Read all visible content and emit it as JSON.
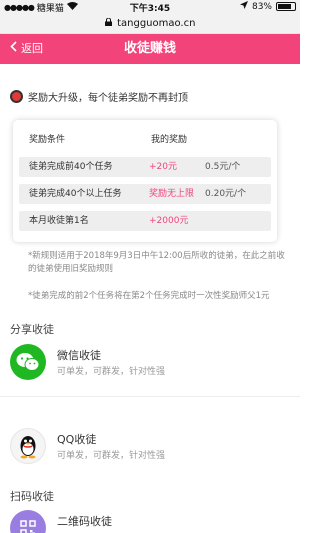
{
  "status_bar": {
    "carrier": "糖果猫",
    "time": "下午3:45",
    "battery_text": "83%",
    "battery_level": 0.83
  },
  "url_bar": {
    "url": "tangguomao.cn"
  },
  "header": {
    "back_label": "返回",
    "title": "收徒赚钱"
  },
  "notice": {
    "text": "奖励大升级，每个徒弟奖励不再封顶"
  },
  "reward_table": {
    "headers": [
      "奖励条件",
      "我的奖励"
    ],
    "rows": [
      {
        "condition": "徒弟完成前40个任务",
        "reward": "+20元",
        "unit": "0.5元/个"
      },
      {
        "condition": "徒弟完成40个以上任务",
        "reward": "奖励无上限",
        "unit": "0.20元/个"
      },
      {
        "condition": "本月收徒第1名",
        "reward": "+2000元",
        "unit": ""
      }
    ]
  },
  "notes": [
    "*新规则适用于2018年9月3日中午12:00后所收的徒弟，在此之前收的徒弟使用旧奖励规则",
    "*徒弟完成的前2个任务将在第2个任务完成时一次性奖励师父1元"
  ],
  "share_section": {
    "title": "分享收徒",
    "items": [
      {
        "name": "微信收徒",
        "desc": "可单发，可群发，针对性强",
        "icon": "wechat-icon"
      },
      {
        "name": "QQ收徒",
        "desc": "可单发，可群发，针对性强",
        "icon": "qq-icon"
      }
    ]
  },
  "qr_section": {
    "title": "扫码收徒",
    "items": [
      {
        "name": "二维码收徒",
        "icon": "qr-code-icon"
      }
    ]
  },
  "colors": {
    "brand": "#f2447b",
    "wechat": "#1fb823",
    "qr": "#9a7de0"
  }
}
